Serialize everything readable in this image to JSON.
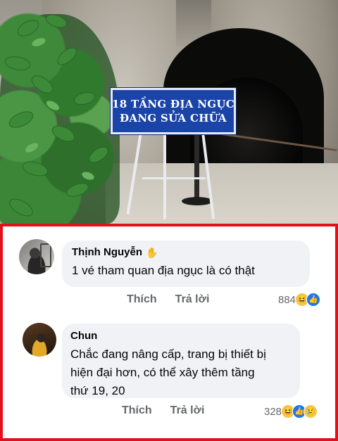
{
  "photo": {
    "sign_line1": "18 TẦNG ĐỊA NGỤC",
    "sign_line2": "ĐANG SỬA CHỮA"
  },
  "comments": [
    {
      "author": "Thịnh Nguyễn",
      "author_badge_icon": "wave-hand-icon",
      "text": "1 vé tham quan địa ngục là có thật",
      "like_label": "Thích",
      "reply_label": "Trả lời",
      "reaction_count": "884",
      "reactions": [
        "haha",
        "like"
      ]
    },
    {
      "author": "Chun",
      "text_lines": [
        "Chắc đang nâng cấp, trang bị thiết bị",
        "hiện đại hơn, có thể xây thêm tầng",
        "thứ 19, 20"
      ],
      "like_label": "Thích",
      "reply_label": "Trả lời",
      "reaction_count": "328",
      "reactions": [
        "haha",
        "like",
        "sad"
      ]
    }
  ],
  "colors": {
    "highlight_border": "#e0111b",
    "bubble_bg": "#f0f2f5",
    "sign_blue": "#1b44a8",
    "like_blue": "#1877f2"
  }
}
